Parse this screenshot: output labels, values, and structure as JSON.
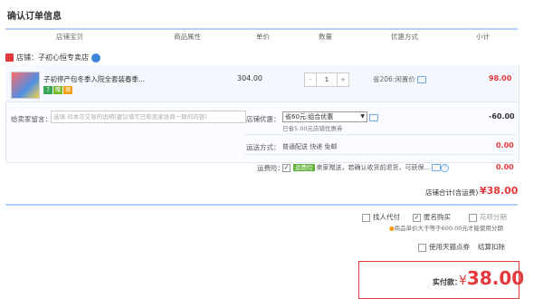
{
  "page": {
    "title": "确认订单信息"
  },
  "columns": [
    "店铺宝贝",
    "商品属性",
    "单价",
    "数量",
    "优惠方式",
    "小计"
  ],
  "shop": {
    "label": "店铺：",
    "name": "子初心恒专卖店"
  },
  "item": {
    "name": "子初停产包冬季入院全套装春季...",
    "tags": [
      "7",
      "赠",
      "保"
    ],
    "price": "304.00",
    "qty": "1",
    "qty_minus": "-",
    "qty_plus": "+",
    "promo": "省206:闲置价",
    "subtotal": "98.00"
  },
  "memo": {
    "label": "给卖家留言：",
    "placeholder": "选填:对本次交易的说明(建议填写已和卖家协商一致的内容)"
  },
  "discount": {
    "label": "店铺优惠：",
    "selected": "省60元:组合优惠",
    "note": "已省5.00元店铺优惠券",
    "value": "-60.00"
  },
  "shipping": {
    "label": "运送方式：",
    "text": "普通配送 快递 免邮",
    "value": "0.00"
  },
  "insurance": {
    "label": "运费险：",
    "badge": "运费险",
    "text": "卖家赠送，若确认收货前退货，可获保...",
    "value": "0.00"
  },
  "shop_total": {
    "label": "店铺合计(含运费)",
    "value": "¥38.00"
  },
  "options": {
    "proxy_pay": "找人代付",
    "anonymous": "匿名购买",
    "installment": "花呗分期",
    "installment_note": "商品单价大于等于600.00元才能使用分期",
    "tmall_points": "使用天猫点券",
    "points_label": "结算扣除"
  },
  "pay": {
    "label": "实付款：",
    "currency": "¥",
    "amount": "38.00"
  },
  "colors": {
    "accent": "#e4393c",
    "header_line": "#b2d1ff"
  }
}
